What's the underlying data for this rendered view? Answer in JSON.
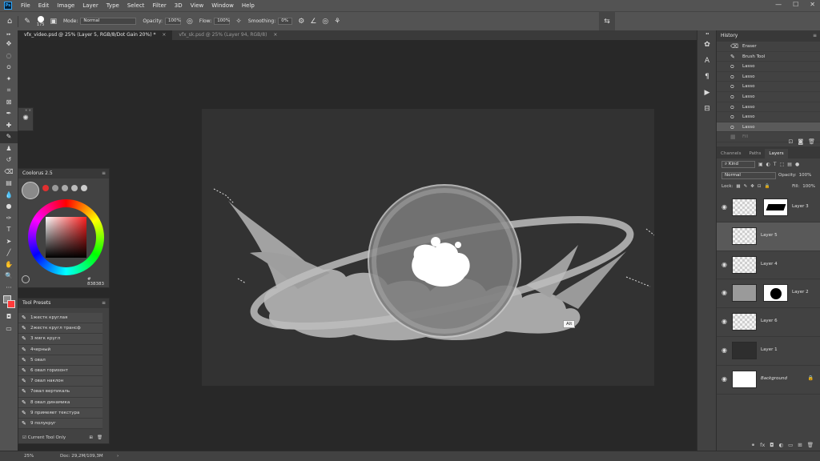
{
  "app": {
    "menu": [
      "File",
      "Edit",
      "Image",
      "Layer",
      "Type",
      "Select",
      "Filter",
      "3D",
      "View",
      "Window",
      "Help"
    ],
    "ps_logo": "Ps"
  },
  "options_bar": {
    "brush_size": "175",
    "mode_label": "Mode:",
    "mode_value": "Normal",
    "opacity_label": "Opacity:",
    "opacity_value": "100%",
    "flow_label": "Flow:",
    "flow_value": "100%",
    "smoothing_label": "Smoothing:",
    "smoothing_value": "0%"
  },
  "tabs": [
    {
      "label": "vfx_video.psd @ 25% (Layer 5, RGB/8/Dot Gain 20%) *",
      "close": "×"
    },
    {
      "label": "vfx_sk.psd @ 25% (Layer 94, RGB/8)",
      "close": "×"
    }
  ],
  "coolorus": {
    "title": "Coolorus 2.5",
    "hex_value": "# 838383"
  },
  "tool_presets": {
    "title": "Tool Presets",
    "items": [
      "1жестк круглая",
      "2жестк кругл трансф",
      "3 мягк кругл",
      "4черный",
      "5 овал",
      "6 овал горизонт",
      "7 овал наклон",
      "7овал вертикаль",
      "8 овал динамика",
      "9 примеяет текстура",
      "9 полукруг"
    ],
    "current_tool_only": "Current Tool Only"
  },
  "history": {
    "title": "History",
    "items": [
      "Eraser",
      "Brush Tool",
      "Lasso",
      "Lasso",
      "Lasso",
      "Lasso",
      "Lasso",
      "Lasso",
      "Lasso",
      "Fill"
    ]
  },
  "layers_panel": {
    "tabs": [
      "Channels",
      "Paths",
      "Layers"
    ],
    "kind": "Kind",
    "blend": "Normal",
    "opacity_label": "Opacity:",
    "opacity_value": "100%",
    "lock_label": "Lock:",
    "fill_label": "Fill:",
    "fill_value": "100%",
    "layers": [
      {
        "name": "Layer 3",
        "has_mask": true
      },
      {
        "name": "Layer 5",
        "has_mask": false
      },
      {
        "name": "Layer 4",
        "has_mask": false
      },
      {
        "name": "Layer 2",
        "has_mask": true
      },
      {
        "name": "Layer 6",
        "has_mask": false
      },
      {
        "name": "Layer 1",
        "has_mask": false
      },
      {
        "name": "Background",
        "has_mask": false
      }
    ]
  },
  "canvas": {
    "alt_tooltip": "Alt"
  },
  "status": {
    "zoom": "25%",
    "doc": "Doc: 29,2M/109,3M"
  },
  "colors": {
    "accent": "#31a8ff",
    "panel": "#424242",
    "canvas": "#282828"
  }
}
